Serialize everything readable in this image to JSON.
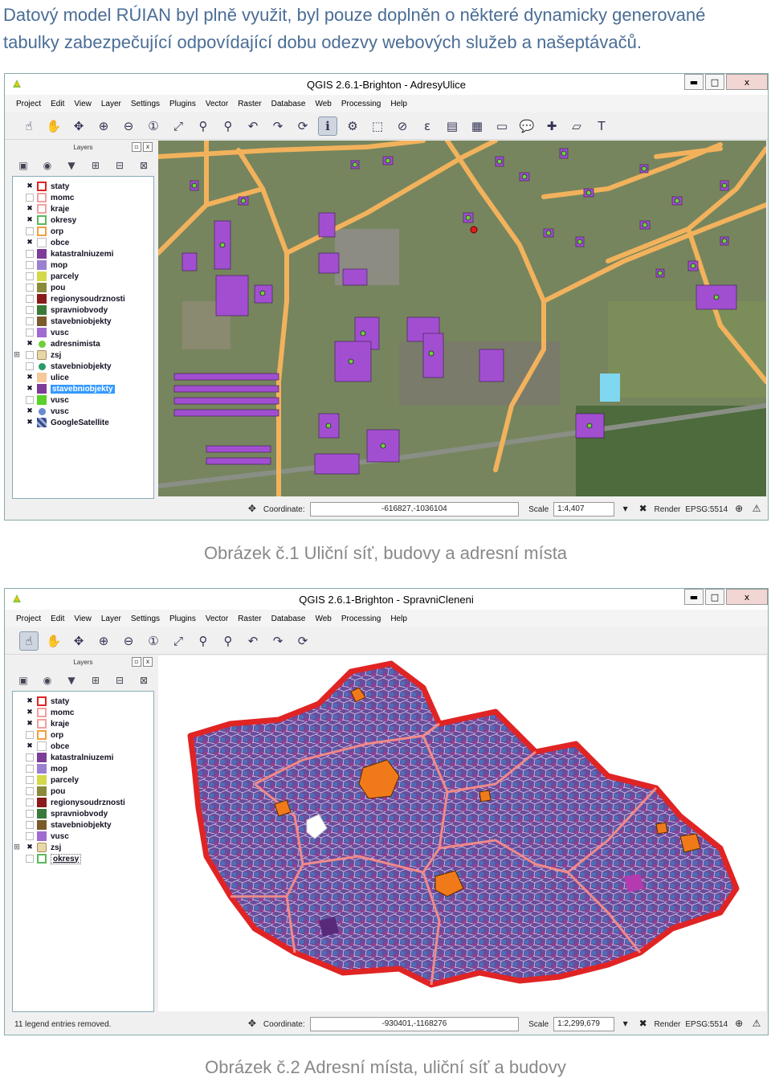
{
  "intro_text": "Datový model RÚIAN byl plně využit, byl pouze doplněn o některé dynamicky generované tabulky zabezpečující odpovídající dobu odezvy webových služeb a našeptávačů.",
  "captions": [
    "Obrázek č.1 Uliční síť, budovy a adresní místa",
    "Obrázek č.2 Adresní místa, uliční síť a budovy"
  ],
  "menu": [
    "Project",
    "Edit",
    "View",
    "Layer",
    "Settings",
    "Plugins",
    "Vector",
    "Raster",
    "Database",
    "Web",
    "Processing",
    "Help"
  ],
  "window_buttons": {
    "minimize": "▬",
    "maximize": "□",
    "close": "x"
  },
  "layers_panel_title": "Layers",
  "colors": {
    "titlebar_accent": "#d0e0f0",
    "selection": "#3399ff",
    "state_border": "#e02424",
    "region_border": "#f08080",
    "orange_area": "#f07a1a",
    "purple_fill": "#8a50c0",
    "road": "#f2b25c"
  },
  "window1": {
    "title": "QGIS 2.6.1-Brighton - AdresyUlice",
    "layers": [
      {
        "name": "staty",
        "checked": true,
        "symbol": "red-outline"
      },
      {
        "name": "momc",
        "checked": false,
        "symbol": "pink-outline"
      },
      {
        "name": "kraje",
        "checked": true,
        "symbol": "pink-outline"
      },
      {
        "name": "okresy",
        "checked": true,
        "symbol": "green-outline"
      },
      {
        "name": "orp",
        "checked": false,
        "symbol": "orange-outline"
      },
      {
        "name": "obce",
        "checked": true,
        "symbol": "white-outline"
      },
      {
        "name": "katastralniuzemi",
        "checked": false,
        "symbol": "purple-fill"
      },
      {
        "name": "mop",
        "checked": false,
        "symbol": "lavender-fill"
      },
      {
        "name": "parcely",
        "checked": false,
        "symbol": "yellow-fill"
      },
      {
        "name": "pou",
        "checked": false,
        "symbol": "olive-fill"
      },
      {
        "name": "regionysoudrznosti",
        "checked": false,
        "symbol": "darkred-fill"
      },
      {
        "name": "spravniobvody",
        "checked": false,
        "symbol": "green-fill"
      },
      {
        "name": "stavebniobjekty",
        "checked": false,
        "symbol": "brown-fill"
      },
      {
        "name": "vusc",
        "checked": false,
        "symbol": "violet-fill"
      },
      {
        "name": "adresnimista",
        "checked": true,
        "symbol": "green-dot"
      },
      {
        "name": "zsj",
        "checked": false,
        "symbol": "group",
        "expandable": true
      },
      {
        "name": "stavebniobjekty",
        "checked": false,
        "symbol": "teal-dot"
      },
      {
        "name": "ulice",
        "checked": true,
        "symbol": "peach-fill"
      },
      {
        "name": "stavebniobjekty",
        "checked": true,
        "symbol": "purple-fill",
        "selected": true
      },
      {
        "name": "vusc",
        "checked": false,
        "symbol": "lime-fill"
      },
      {
        "name": "vusc",
        "checked": true,
        "symbol": "blue-dot"
      },
      {
        "name": "GoogleSatellite",
        "checked": true,
        "symbol": "raster"
      }
    ],
    "status": {
      "message": "",
      "coordinate_label": "Coordinate:",
      "coordinate": "-616827,-1036104",
      "scale_label": "Scale",
      "scale": "1:4,407",
      "render_label": "Render",
      "crs": "EPSG:5514"
    }
  },
  "window2": {
    "title": "QGIS 2.6.1-Brighton - SpravniCleneni",
    "layers": [
      {
        "name": "staty",
        "checked": true,
        "symbol": "red-outline"
      },
      {
        "name": "momc",
        "checked": true,
        "symbol": "pink-outline"
      },
      {
        "name": "kraje",
        "checked": true,
        "symbol": "pink-outline"
      },
      {
        "name": "orp",
        "checked": false,
        "symbol": "orange-outline"
      },
      {
        "name": "obce",
        "checked": true,
        "symbol": "white-outline"
      },
      {
        "name": "katastralniuzemi",
        "checked": false,
        "symbol": "purple-fill"
      },
      {
        "name": "mop",
        "checked": false,
        "symbol": "lavender-fill"
      },
      {
        "name": "parcely",
        "checked": false,
        "symbol": "yellow-fill"
      },
      {
        "name": "pou",
        "checked": false,
        "symbol": "olive-fill"
      },
      {
        "name": "regionysoudrznosti",
        "checked": false,
        "symbol": "darkred-fill"
      },
      {
        "name": "spravniobvody",
        "checked": false,
        "symbol": "green-fill"
      },
      {
        "name": "stavebniobjekty",
        "checked": false,
        "symbol": "brown-fill"
      },
      {
        "name": "vusc",
        "checked": false,
        "symbol": "violet-fill"
      },
      {
        "name": "zsj",
        "checked": true,
        "symbol": "group",
        "expandable": true
      },
      {
        "name": "okresy",
        "checked": false,
        "symbol": "green-outline",
        "underlined": true
      }
    ],
    "status": {
      "message": "11 legend entries removed.",
      "coordinate_label": "Coordinate:",
      "coordinate": "-930401,-1168276",
      "scale_label": "Scale",
      "scale": "1:2,299,679",
      "render_label": "Render",
      "crs": "EPSG:5514"
    }
  }
}
